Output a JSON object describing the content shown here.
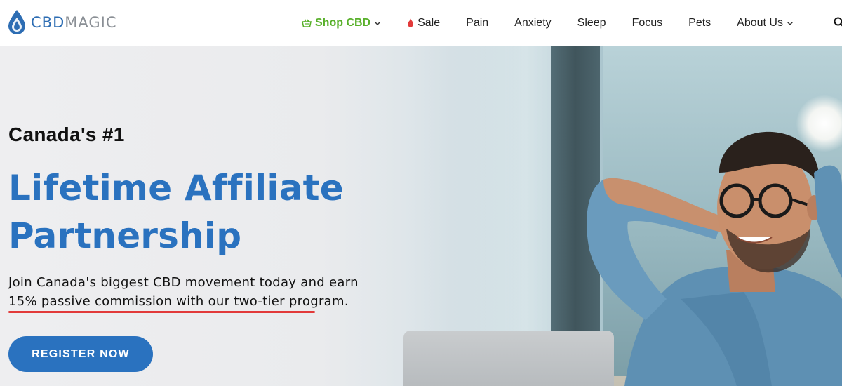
{
  "brand": {
    "name_part1": "CBD",
    "name_part2": "MAGIC"
  },
  "nav": {
    "items": [
      {
        "label": "Shop CBD",
        "icon": "basket-icon",
        "dropdown": true
      },
      {
        "label": "Sale",
        "icon": "flame-icon",
        "dropdown": false
      },
      {
        "label": "Pain",
        "dropdown": false
      },
      {
        "label": "Anxiety",
        "dropdown": false
      },
      {
        "label": "Sleep",
        "dropdown": false
      },
      {
        "label": "Focus",
        "dropdown": false
      },
      {
        "label": "Pets",
        "dropdown": false
      },
      {
        "label": "About Us",
        "dropdown": true
      }
    ],
    "search_icon": "search-icon"
  },
  "hero": {
    "eyebrow": "Canada's #1",
    "headline_line1": "Lifetime Affiliate",
    "headline_line2": "Partnership",
    "subtext_line1": "Join Canada's biggest CBD movement today and earn",
    "subtext_line2": "15% passive commission with our two-tier program.",
    "cta_label": "REGISTER NOW"
  },
  "colors": {
    "brand_blue": "#2a72bf",
    "shop_green": "#58b02a",
    "sale_red": "#e23a3a",
    "underline_red": "#e23a3a"
  }
}
